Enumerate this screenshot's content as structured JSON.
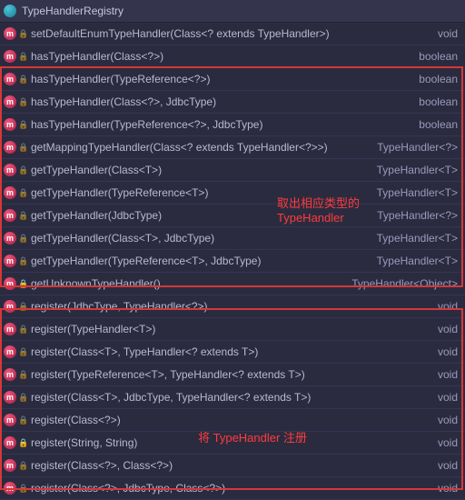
{
  "header": {
    "title": "TypeHandlerRegistry"
  },
  "rows": [
    {
      "locked": false,
      "sig": "setDefaultEnumTypeHandler(Class<? extends TypeHandler>)",
      "ret": "void"
    },
    {
      "locked": false,
      "sig": "hasTypeHandler(Class<?>)",
      "ret": "boolean"
    },
    {
      "locked": false,
      "sig": "hasTypeHandler(TypeReference<?>)",
      "ret": "boolean"
    },
    {
      "locked": false,
      "sig": "hasTypeHandler(Class<?>, JdbcType)",
      "ret": "boolean"
    },
    {
      "locked": false,
      "sig": "hasTypeHandler(TypeReference<?>, JdbcType)",
      "ret": "boolean"
    },
    {
      "locked": false,
      "sig": "getMappingTypeHandler(Class<? extends TypeHandler<?>>)",
      "ret": "TypeHandler<?>"
    },
    {
      "locked": false,
      "sig": "getTypeHandler(Class<T>)",
      "ret": "TypeHandler<T>"
    },
    {
      "locked": false,
      "sig": "getTypeHandler(TypeReference<T>)",
      "ret": "TypeHandler<T>"
    },
    {
      "locked": false,
      "sig": "getTypeHandler(JdbcType)",
      "ret": "TypeHandler<?>"
    },
    {
      "locked": false,
      "sig": "getTypeHandler(Class<T>, JdbcType)",
      "ret": "TypeHandler<T>"
    },
    {
      "locked": false,
      "sig": "getTypeHandler(TypeReference<T>, JdbcType)",
      "ret": "TypeHandler<T>"
    },
    {
      "locked": true,
      "sig": "getUnknownTypeHandler()",
      "ret": "TypeHandler<Object>"
    },
    {
      "locked": false,
      "sig": "register(JdbcType, TypeHandler<?>)",
      "ret": "void"
    },
    {
      "locked": false,
      "sig": "register(TypeHandler<T>)",
      "ret": "void"
    },
    {
      "locked": false,
      "sig": "register(Class<T>, TypeHandler<? extends T>)",
      "ret": "void"
    },
    {
      "locked": false,
      "sig": "register(TypeReference<T>, TypeHandler<? extends T>)",
      "ret": "void"
    },
    {
      "locked": false,
      "sig": "register(Class<T>, JdbcType, TypeHandler<? extends T>)",
      "ret": "void"
    },
    {
      "locked": false,
      "sig": "register(Class<?>)",
      "ret": "void"
    },
    {
      "locked": true,
      "sig": "register(String, String)",
      "ret": "void"
    },
    {
      "locked": false,
      "sig": "register(Class<?>, Class<?>)",
      "ret": "void"
    },
    {
      "locked": false,
      "sig": "register(Class<?>, JdbcType, Class<?>)",
      "ret": "void"
    }
  ],
  "annotations": {
    "a1_line1": "取出相应类型的",
    "a1_line2": "TypeHandler",
    "a2": "将 TypeHandler 注册"
  },
  "icons": {
    "method_letter": "m",
    "lock_glyph": "🔒"
  }
}
